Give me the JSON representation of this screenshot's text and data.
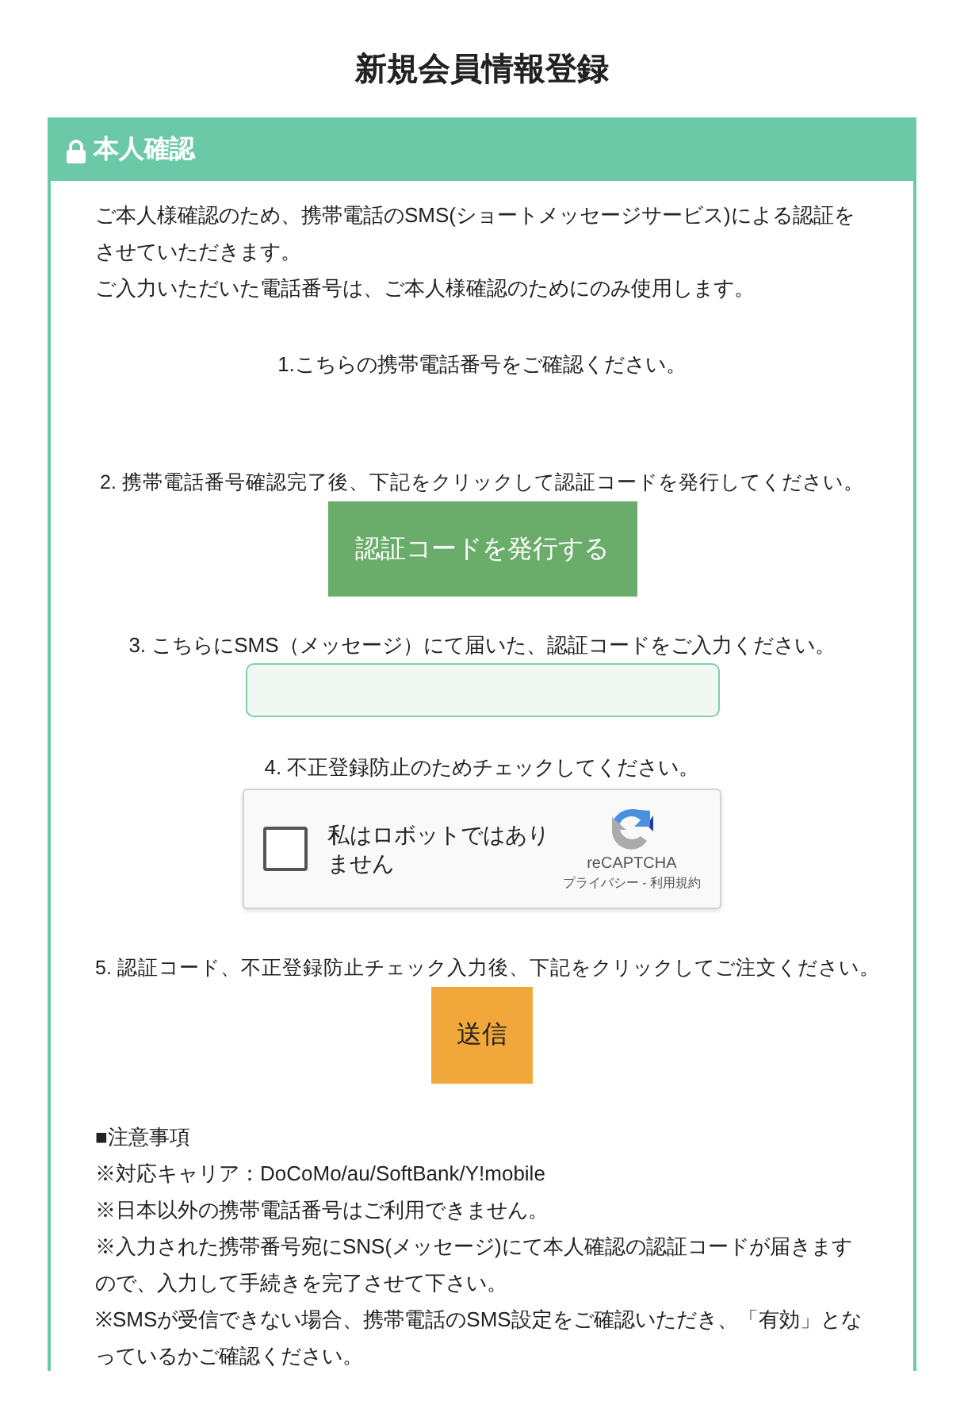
{
  "page_title": "新規会員情報登録",
  "panel": {
    "title": "本人確認",
    "intro": [
      "ご本人様確認のため、携帯電話のSMS(ショートメッセージサービス)による認証をさせていただきます。",
      "ご入力いただいた電話番号は、ご本人様確認のためにのみ使用します。"
    ],
    "step1": "1.こちらの携帯電話番号をご確認ください。",
    "step2": "2. 携帯電話番号確認完了後、下記をクリックして認証コードを発行してください。",
    "issue_button": "認証コードを発行する",
    "step3": "3. こちらにSMS（メッセージ）にて届いた、認証コードをご入力ください。",
    "step4": "4. 不正登録防止のためチェックしてください。",
    "captcha": {
      "label": "私はロボットではありません",
      "checked": false,
      "brand": "reCAPTCHA",
      "links": "プライバシー - 利用規約"
    },
    "step5": "5. 認証コード、不正登録防止チェック入力後、下記をクリックしてご注文ください。",
    "submit_button": "送信",
    "notes_title": "■注意事項",
    "notes": [
      "※対応キャリア：DoCoMo/au/SoftBank/Y!mobile",
      "※日本以外の携帯電話番号はご利用できません。",
      "※入力された携帯番号宛にSNS(メッセージ)にて本人確認の認証コードが届きますので、入力して手続きを完了させて下さい。",
      "※SMSが受信できない場合、携帯電話のSMS設定をご確認いただき、「有効」となっているかご確認ください。"
    ]
  }
}
